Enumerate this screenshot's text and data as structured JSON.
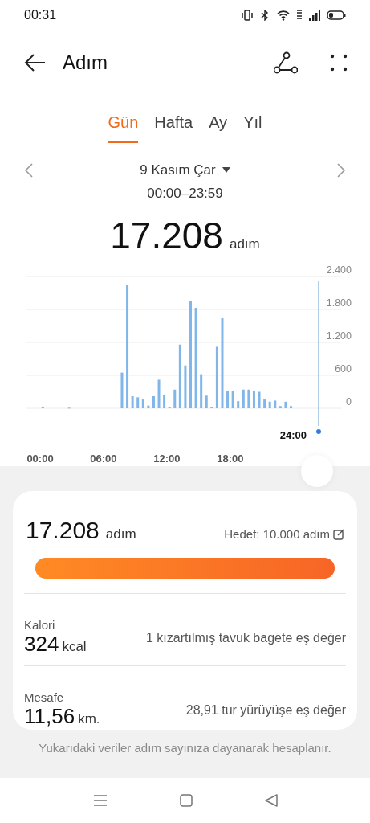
{
  "status_bar": {
    "time": "00:31"
  },
  "header": {
    "title": "Adım"
  },
  "tabs": [
    {
      "label": "Gün",
      "selected": true
    },
    {
      "label": "Hafta",
      "selected": false
    },
    {
      "label": "Ay",
      "selected": false
    },
    {
      "label": "Yıl",
      "selected": false
    }
  ],
  "date": {
    "label": "9 Kasım Çar",
    "range": "00:00–23:59"
  },
  "total": {
    "value": "17.208",
    "unit": "adım"
  },
  "chart": {
    "cursor_label": "24:00",
    "chart_data": {
      "type": "bar",
      "x": [
        0,
        2.5,
        7.5,
        8,
        8.5,
        9,
        9.5,
        10,
        10.5,
        11,
        11.5,
        12,
        12.5,
        13,
        13.5,
        14,
        14.5,
        15,
        15.5,
        16,
        16.5,
        17,
        17.5,
        18,
        18.5,
        19,
        19.5,
        20,
        20.5,
        21,
        21.5,
        22,
        22.5,
        23,
        23.5
      ],
      "series": [
        {
          "color": "#80b6ea",
          "values": [
            30,
            10,
            650,
            2250,
            220,
            200,
            160,
            50,
            220,
            520,
            250,
            20,
            340,
            1160,
            780,
            1960,
            1830,
            620,
            230,
            20,
            1120,
            1640,
            320,
            320,
            130,
            340,
            340,
            320,
            300,
            160,
            120,
            140,
            40,
            120,
            40
          ]
        }
      ],
      "grid": true,
      "xlim": [
        0,
        24
      ],
      "ylim": [
        0,
        2400
      ],
      "yticks": [
        {
          "value": 0,
          "label": "0"
        },
        {
          "value": 600,
          "label": "600"
        },
        {
          "value": 1200,
          "label": "1.200"
        },
        {
          "value": 1800,
          "label": "1.800"
        },
        {
          "value": 2400,
          "label": "2.400"
        }
      ],
      "xticks": [
        {
          "value": 0,
          "label": "00:00"
        },
        {
          "value": 6,
          "label": "06:00"
        },
        {
          "value": 12,
          "label": "12:00"
        },
        {
          "value": 18,
          "label": "18:00"
        }
      ]
    }
  },
  "summary": {
    "value": "17.208",
    "unit": "adım",
    "goal": "Hedef: 10.000 adım",
    "level": 1,
    "metrics": [
      {
        "label": "Kalori",
        "value": "324",
        "unit": "kcal",
        "equivalent": "1 kızartılmış tavuk bagete eş değer"
      },
      {
        "label": "Mesafe",
        "value": "11,56",
        "unit": "km.",
        "equivalent": "28,91 tur yürüyüşe eş değer"
      }
    ]
  },
  "footnote": "Yukarıdaki veriler adım sayınıza dayanarak hesaplanır."
}
